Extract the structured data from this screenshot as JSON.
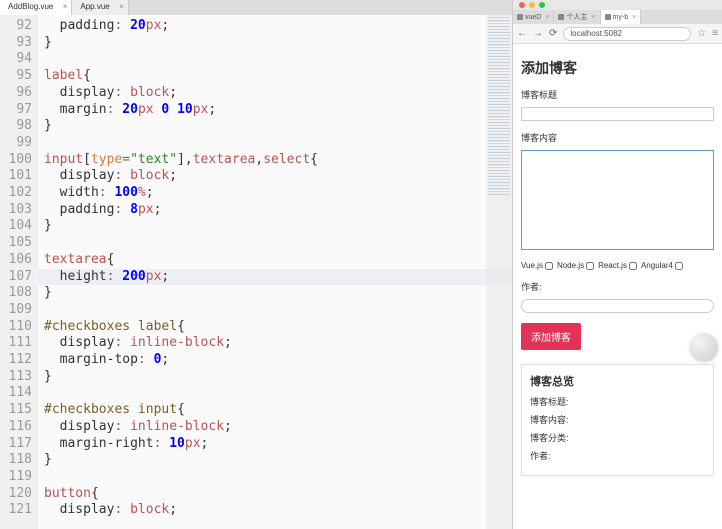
{
  "editor": {
    "tabs": [
      {
        "label": "AddBlog.vue",
        "active": true
      },
      {
        "label": "App.vue",
        "active": false
      }
    ],
    "lineStart": 92,
    "highlightedLine": 107,
    "lines": [
      [
        {
          "t": "  padding",
          "c": "prop"
        },
        {
          "t": ": ",
          "c": "op"
        },
        {
          "t": "20",
          "c": "num"
        },
        {
          "t": "px",
          "c": "pct"
        },
        {
          "t": ";",
          "c": "punc"
        }
      ],
      [
        {
          "t": "}",
          "c": "punc"
        }
      ],
      [],
      [
        {
          "t": "label",
          "c": "selred"
        },
        {
          "t": "{",
          "c": "punc"
        }
      ],
      [
        {
          "t": "  display",
          "c": "prop"
        },
        {
          "t": ": ",
          "c": "op"
        },
        {
          "t": "block",
          "c": "val"
        },
        {
          "t": ";",
          "c": "punc"
        }
      ],
      [
        {
          "t": "  margin",
          "c": "prop"
        },
        {
          "t": ": ",
          "c": "op"
        },
        {
          "t": "20",
          "c": "num"
        },
        {
          "t": "px ",
          "c": "pct"
        },
        {
          "t": "0",
          "c": "num"
        },
        {
          "t": " ",
          "c": "punc"
        },
        {
          "t": "10",
          "c": "num"
        },
        {
          "t": "px",
          "c": "pct"
        },
        {
          "t": ";",
          "c": "punc"
        }
      ],
      [
        {
          "t": "}",
          "c": "punc"
        }
      ],
      [],
      [
        {
          "t": "input",
          "c": "selred"
        },
        {
          "t": "[",
          "c": "punc"
        },
        {
          "t": "type",
          "c": "attr"
        },
        {
          "t": "=",
          "c": "op"
        },
        {
          "t": "\"text\"",
          "c": "selgreen"
        },
        {
          "t": "]",
          "c": "punc"
        },
        {
          "t": ",",
          "c": "punc"
        },
        {
          "t": "textarea",
          "c": "selred"
        },
        {
          "t": ",",
          "c": "punc"
        },
        {
          "t": "select",
          "c": "selred"
        },
        {
          "t": "{",
          "c": "punc"
        }
      ],
      [
        {
          "t": "  display",
          "c": "prop"
        },
        {
          "t": ": ",
          "c": "op"
        },
        {
          "t": "block",
          "c": "val"
        },
        {
          "t": ";",
          "c": "punc"
        }
      ],
      [
        {
          "t": "  width",
          "c": "prop"
        },
        {
          "t": ": ",
          "c": "op"
        },
        {
          "t": "100",
          "c": "num"
        },
        {
          "t": "%",
          "c": "pct"
        },
        {
          "t": ";",
          "c": "punc"
        }
      ],
      [
        {
          "t": "  padding",
          "c": "prop"
        },
        {
          "t": ": ",
          "c": "op"
        },
        {
          "t": "8",
          "c": "num"
        },
        {
          "t": "px",
          "c": "pct"
        },
        {
          "t": ";",
          "c": "punc"
        }
      ],
      [
        {
          "t": "}",
          "c": "punc"
        }
      ],
      [],
      [
        {
          "t": "textarea",
          "c": "selred"
        },
        {
          "t": "{",
          "c": "punc"
        }
      ],
      [
        {
          "t": "  height",
          "c": "prop"
        },
        {
          "t": ": ",
          "c": "op"
        },
        {
          "t": "200",
          "c": "num"
        },
        {
          "t": "px",
          "c": "pct"
        },
        {
          "t": ";",
          "c": "punc"
        }
      ],
      [
        {
          "t": "}",
          "c": "punc"
        }
      ],
      [],
      [
        {
          "t": "#checkboxes label",
          "c": "sel"
        },
        {
          "t": "{",
          "c": "punc"
        }
      ],
      [
        {
          "t": "  display",
          "c": "prop"
        },
        {
          "t": ": ",
          "c": "op"
        },
        {
          "t": "inline-block",
          "c": "val"
        },
        {
          "t": ";",
          "c": "punc"
        }
      ],
      [
        {
          "t": "  margin-top",
          "c": "prop"
        },
        {
          "t": ": ",
          "c": "op"
        },
        {
          "t": "0",
          "c": "num"
        },
        {
          "t": ";",
          "c": "punc"
        }
      ],
      [
        {
          "t": "}",
          "c": "punc"
        }
      ],
      [],
      [
        {
          "t": "#checkboxes input",
          "c": "sel"
        },
        {
          "t": "{",
          "c": "punc"
        }
      ],
      [
        {
          "t": "  display",
          "c": "prop"
        },
        {
          "t": ": ",
          "c": "op"
        },
        {
          "t": "inline-block",
          "c": "val"
        },
        {
          "t": ";",
          "c": "punc"
        }
      ],
      [
        {
          "t": "  margin-right",
          "c": "prop"
        },
        {
          "t": ": ",
          "c": "op"
        },
        {
          "t": "10",
          "c": "num"
        },
        {
          "t": "px",
          "c": "pct"
        },
        {
          "t": ";",
          "c": "punc"
        }
      ],
      [
        {
          "t": "}",
          "c": "punc"
        }
      ],
      [],
      [
        {
          "t": "button",
          "c": "selred"
        },
        {
          "t": "{",
          "c": "punc"
        }
      ],
      [
        {
          "t": "  display",
          "c": "prop"
        },
        {
          "t": ": ",
          "c": "op"
        },
        {
          "t": "block",
          "c": "val"
        },
        {
          "t": ";",
          "c": "punc"
        }
      ]
    ]
  },
  "browser": {
    "tabs": [
      {
        "label": "vueD"
      },
      {
        "label": "个人主"
      },
      {
        "label": "my-b",
        "active": true
      }
    ],
    "url": "localhost:5082",
    "page": {
      "heading": "添加博客",
      "titleLabel": "博客标题",
      "titleValue": "",
      "contentLabel": "博客内容",
      "contentValue": "",
      "categories": [
        "Vue.js",
        "Node.js",
        "React.js",
        "Angular4"
      ],
      "authorLabel": "作者:",
      "authorValue": "",
      "submitLabel": "添加博客",
      "summary": {
        "heading": "博客总览",
        "titleLabel": "博客标题:",
        "contentLabel": "博客内容:",
        "catLabel": "博客分类:",
        "authorLabel": "作者:"
      }
    }
  }
}
